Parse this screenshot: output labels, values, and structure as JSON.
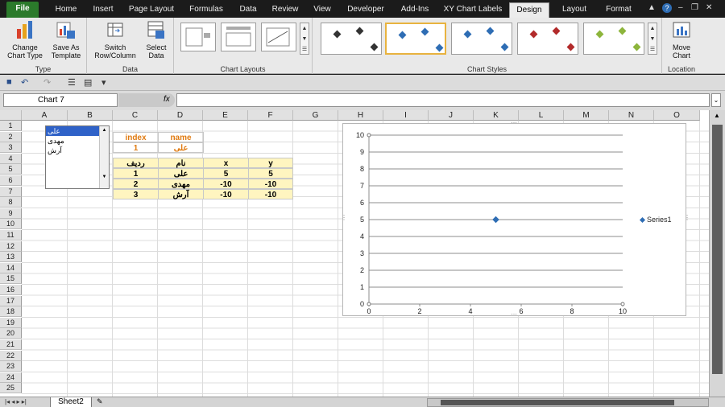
{
  "tabs": [
    "File",
    "Home",
    "Insert",
    "Page Layout",
    "Formulas",
    "Data",
    "Review",
    "View",
    "Developer",
    "Add-Ins",
    "XY Chart Labels",
    "Design",
    "Layout",
    "Format"
  ],
  "active_tab": "Design",
  "ribbon": {
    "groups": [
      {
        "label": "Type",
        "buttons": [
          "Change Chart Type",
          "Save As Template"
        ]
      },
      {
        "label": "Data",
        "buttons": [
          "Switch Row/Column",
          "Select Data"
        ]
      },
      {
        "label": "Chart Layouts"
      },
      {
        "label": "Chart Styles"
      },
      {
        "label": "Location",
        "buttons": [
          "Move Chart"
        ]
      }
    ],
    "change_chart_type_l1": "Change",
    "change_chart_type_l2": "Chart Type",
    "save_as_template_l1": "Save As",
    "save_as_template_l2": "Template",
    "switch_l1": "Switch",
    "switch_l2": "Row/Column",
    "select_l1": "Select",
    "select_l2": "Data",
    "move_l1": "Move",
    "move_l2": "Chart",
    "style_colors": [
      "#333333",
      "#2e6db4",
      "#2e6db4",
      "#b22a2a",
      "#8db53c"
    ]
  },
  "namebox": "Chart 7",
  "fx": "fx",
  "columns": [
    "A",
    "B",
    "C",
    "D",
    "E",
    "F",
    "G",
    "H",
    "I",
    "J",
    "K",
    "L",
    "M",
    "N",
    "O"
  ],
  "rows": [
    "1",
    "2",
    "3",
    "4",
    "5",
    "6",
    "7",
    "8",
    "9",
    "10",
    "11",
    "12",
    "13",
    "14",
    "15",
    "16",
    "17",
    "18",
    "19",
    "20",
    "21",
    "22",
    "23",
    "24",
    "25"
  ],
  "listbox_items": [
    "علی",
    "مهدی",
    "آرش"
  ],
  "index_table": {
    "headers": [
      "index",
      "name"
    ],
    "values": [
      "1",
      "علی"
    ]
  },
  "data_table": {
    "headers": [
      "ردیف",
      "نام",
      "x",
      "y"
    ],
    "rows": [
      [
        "1",
        "علی",
        "5",
        "5"
      ],
      [
        "2",
        "مهدی",
        "-10",
        "-10"
      ],
      [
        "3",
        "آرش",
        "-10",
        "-10"
      ]
    ]
  },
  "chart_data": {
    "type": "scatter",
    "series": [
      {
        "name": "Series1",
        "x": [
          5
        ],
        "y": [
          5
        ]
      }
    ],
    "xlim": [
      0,
      10
    ],
    "ylim": [
      0,
      10
    ],
    "xticks": [
      0,
      2,
      4,
      6,
      8,
      10
    ],
    "yticks": [
      0,
      1,
      2,
      3,
      4,
      5,
      6,
      7,
      8,
      9,
      10
    ],
    "grid": true,
    "legend": "right",
    "marker_color": "#2e6db4"
  },
  "sheet_tab": "Sheet2"
}
